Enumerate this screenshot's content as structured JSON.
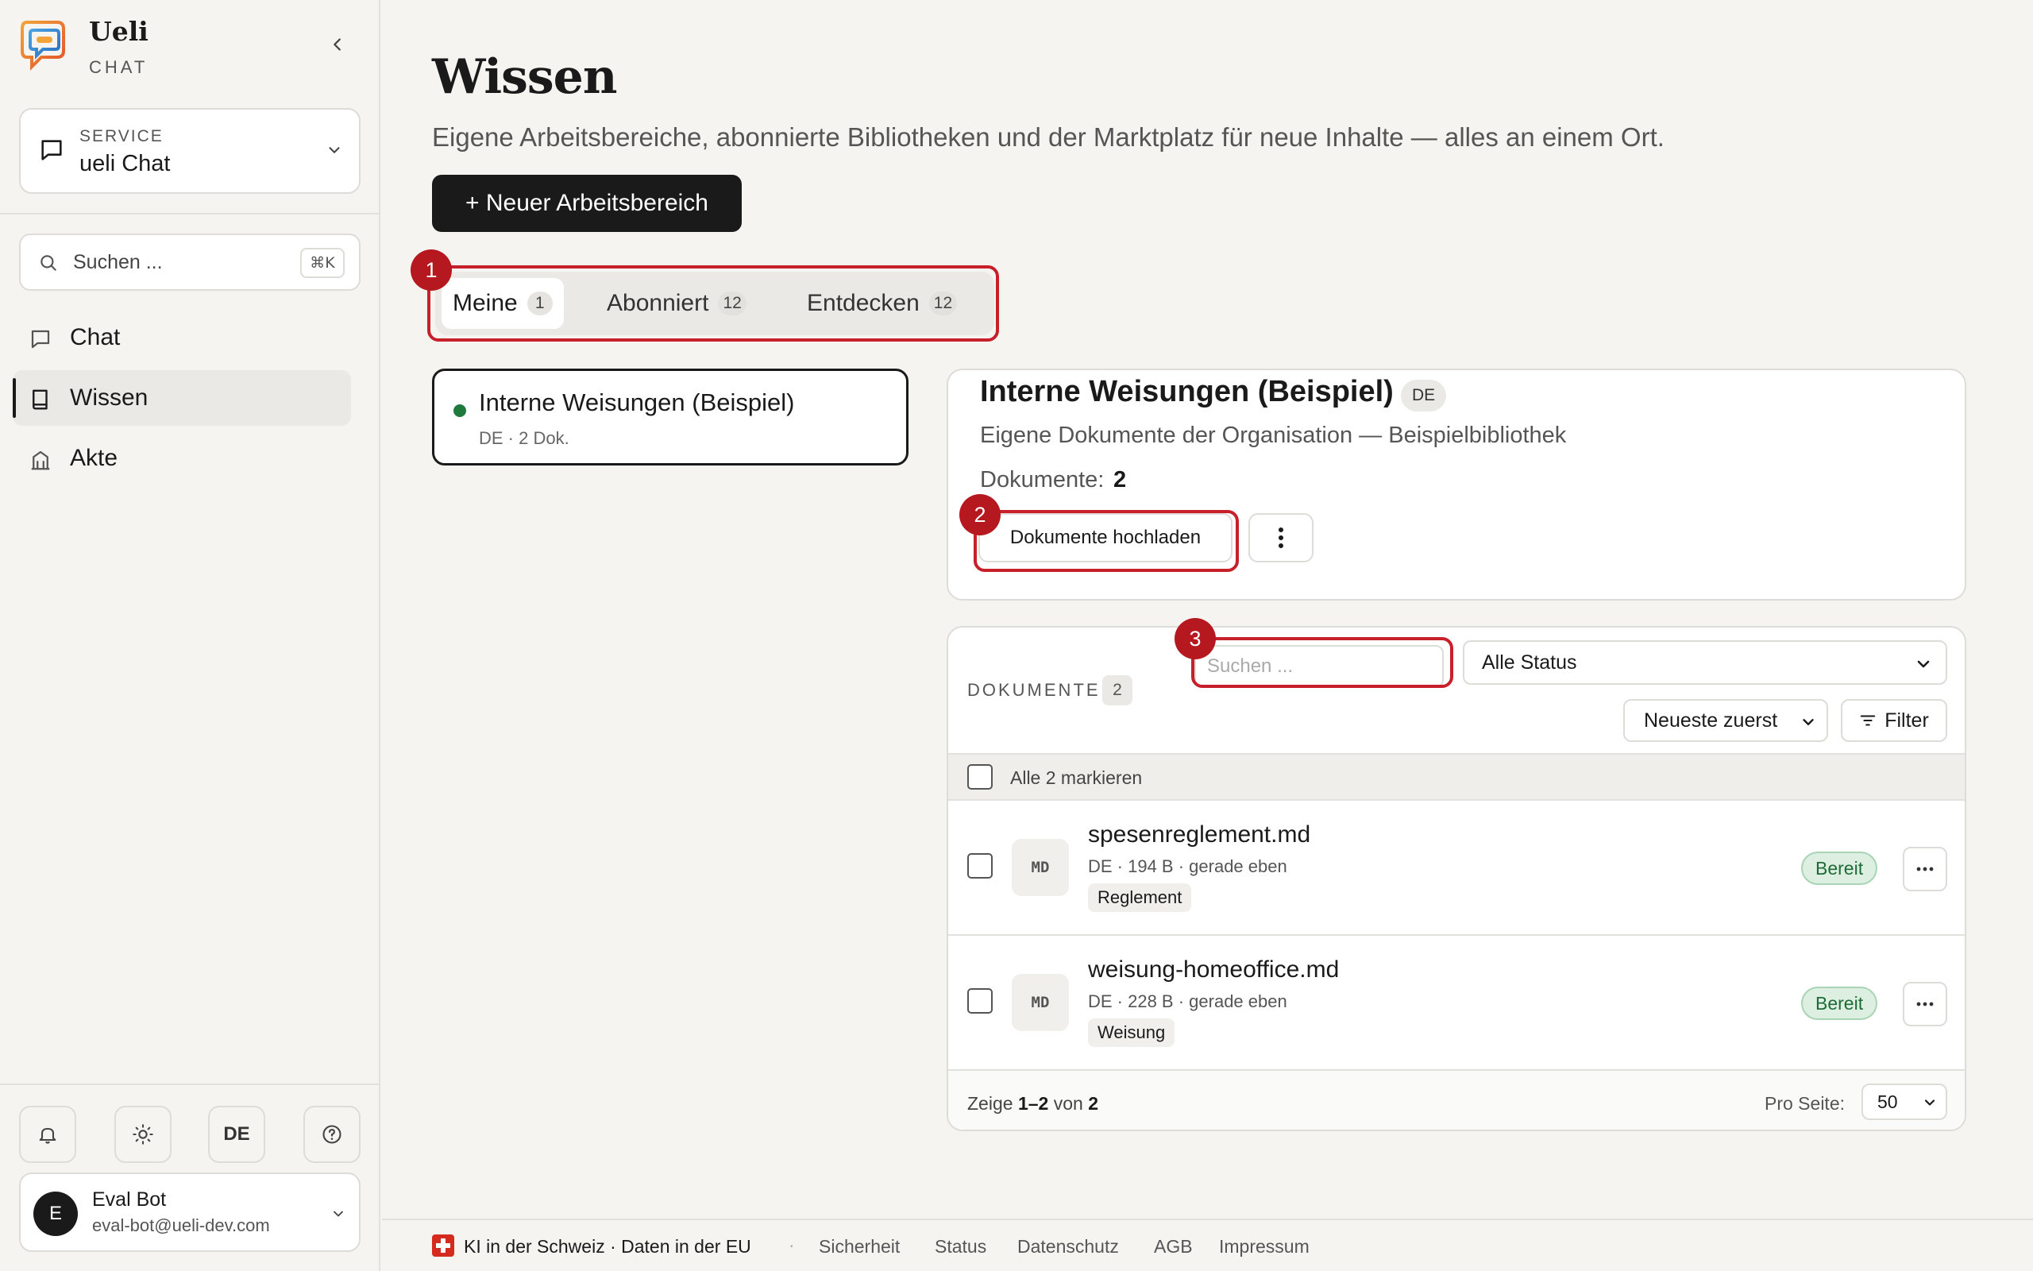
{
  "brand": {
    "name": "Ueli",
    "sub": "CHAT"
  },
  "service": {
    "label": "SERVICE",
    "value": "ueli Chat"
  },
  "search": {
    "placeholder": "Suchen ...",
    "shortcut": "⌘K"
  },
  "nav": [
    {
      "label": "Chat",
      "icon": "chat-bubble-icon",
      "active": false
    },
    {
      "label": "Wissen",
      "icon": "book-icon",
      "active": true
    },
    {
      "label": "Akte",
      "icon": "building-icon",
      "active": false
    }
  ],
  "tools": {
    "notifications": "bell-icon",
    "theme": "sun-icon",
    "language": "DE",
    "help": "help-circle-icon"
  },
  "user": {
    "initial": "E",
    "name": "Eval Bot",
    "email": "eval-bot@ueli-dev.com"
  },
  "page": {
    "title": "Wissen",
    "subtitle": "Eigene Arbeitsbereiche, abonnierte Bibliotheken und der Marktplatz für neue Inhalte — alles an einem Ort.",
    "new_button": "+ Neuer Arbeitsbereich"
  },
  "tabs": [
    {
      "label": "Meine",
      "count": "1",
      "active": true
    },
    {
      "label": "Abonniert",
      "count": "12",
      "active": false
    },
    {
      "label": "Entdecken",
      "count": "12",
      "active": false
    }
  ],
  "annotations": [
    "1",
    "2",
    "3"
  ],
  "library_card": {
    "title": "Interne Weisungen (Beispiel)",
    "meta": "DE  ·  2 Dok."
  },
  "detail": {
    "title": "Interne Weisungen (Beispiel)",
    "lang": "DE",
    "subtitle": "Eigene Dokumente der Organisation — Beispielbibliothek",
    "count_label": "Dokumente:",
    "count_value": "2",
    "upload_button": "Dokumente hochladen"
  },
  "documents": {
    "header_label": "DOKUMENTE",
    "header_count": "2",
    "search_placeholder": "Suchen ...",
    "status_filter": "Alle Status",
    "sort": "Neueste zuerst",
    "filter_button": "Filter",
    "select_all": "Alle 2 markieren",
    "rows": [
      {
        "type": "MD",
        "name": "spesenreglement.md",
        "meta": "DE · 194 B · gerade eben",
        "tag": "Reglement",
        "status": "Bereit"
      },
      {
        "type": "MD",
        "name": "weisung-homeoffice.md",
        "meta": "DE · 228 B · gerade eben",
        "tag": "Weisung",
        "status": "Bereit"
      }
    ],
    "pager": {
      "prefix": "Zeige",
      "range": "1–2",
      "of": "von",
      "total": "2",
      "per_page_label": "Pro Seite:",
      "per_page": "50"
    }
  },
  "footer": {
    "claim": "KI in der Schweiz · Daten in der EU",
    "separator": "·",
    "links": [
      "Sicherheit",
      "Status",
      "Datenschutz",
      "AGB",
      "Impressum"
    ]
  },
  "colors": {
    "accent_dark": "#1a1a1a",
    "annotation_red": "#c8202a",
    "status_green": "#1e6b36",
    "background": "#f5f4f1"
  }
}
